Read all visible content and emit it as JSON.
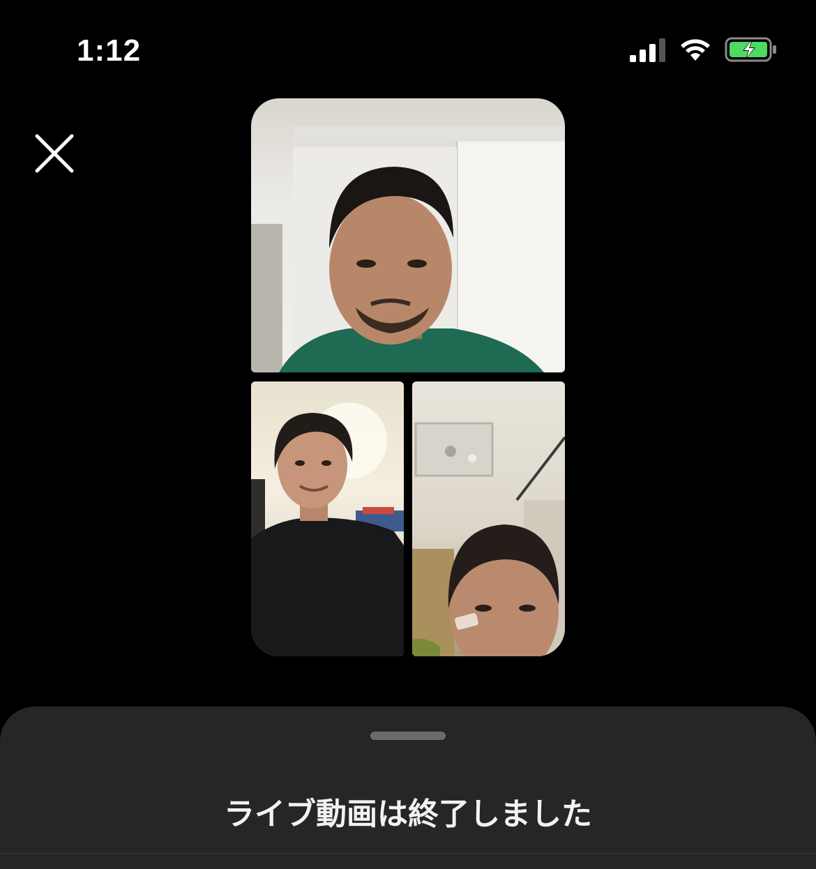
{
  "status_bar": {
    "time": "1:12",
    "signal_icon": "cellular-signal-icon",
    "wifi_icon": "wifi-icon",
    "battery_icon": "battery-charging-icon",
    "battery_color": "#4cd964"
  },
  "toolbar": {
    "close_icon": "close-icon"
  },
  "video_grid": {
    "participants": [
      {
        "tile": "top",
        "description_icon": "participant-video"
      },
      {
        "tile": "bottom-left",
        "description_icon": "participant-video"
      },
      {
        "tile": "bottom-right",
        "description_icon": "participant-video"
      }
    ]
  },
  "bottom_sheet": {
    "title": "ライブ動画は終了しました",
    "background": "#262626"
  }
}
